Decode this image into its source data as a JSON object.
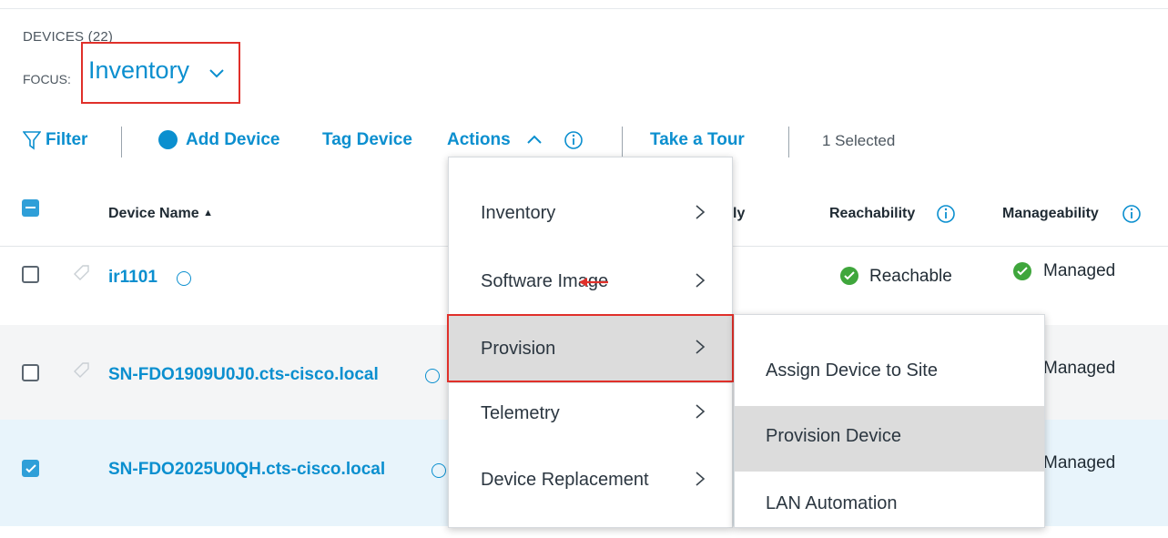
{
  "header": {
    "devices_count": "DEVICES (22)",
    "focus_label": "FOCUS:",
    "focus_value": "Inventory"
  },
  "toolbar": {
    "filter": "Filter",
    "add_device": "Add Device",
    "tag_device": "Tag Device",
    "actions": "Actions",
    "take_tour": "Take a Tour",
    "selected": "1 Selected"
  },
  "table": {
    "columns": {
      "device_name": "Device Name",
      "partial": "ly",
      "reachability": "Reachability",
      "manageability": "Manageability"
    },
    "rows": [
      {
        "name": "ir1101",
        "reachability": "Reachable",
        "manageability": "Managed",
        "checked": false
      },
      {
        "name": "SN-FDO1909U0J0.cts-cisco.local",
        "reachability": "",
        "manageability": "Managed",
        "checked": false
      },
      {
        "name": "SN-FDO2025U0QH.cts-cisco.local",
        "reachability": "",
        "manageability": "Managed",
        "checked": true
      }
    ]
  },
  "actions_menu": {
    "items": [
      {
        "label": "Inventory"
      },
      {
        "label": "Software Image"
      },
      {
        "label": "Provision"
      },
      {
        "label": "Telemetry"
      },
      {
        "label": "Device Replacement"
      }
    ]
  },
  "provision_submenu": {
    "items": [
      {
        "label": "Assign Device to Site"
      },
      {
        "label": "Provision Device"
      },
      {
        "label": "LAN Automation"
      }
    ]
  },
  "colors": {
    "accent": "#0b8fcf",
    "highlight_border": "#e0302a",
    "status_ok": "#3fa63c",
    "selected_row": "#e8f4fb",
    "alt_row": "#f4f5f6"
  }
}
